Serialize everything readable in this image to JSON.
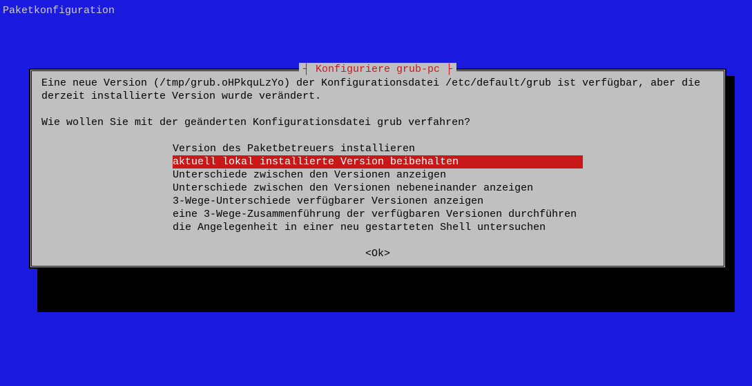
{
  "header": {
    "title": "Paketkonfiguration"
  },
  "dialog": {
    "title": "Konfiguriere grub-pc",
    "body_line1": "Eine neue Version (/tmp/grub.oHPkquLzYo) der Konfigurationsdatei /etc/default/grub ist verfügbar, aber die",
    "body_line2": "derzeit installierte Version wurde verändert.",
    "question": "Wie wollen Sie mit der geänderten Konfigurationsdatei grub verfahren?",
    "options": [
      "Version des Paketbetreuers installieren",
      "aktuell lokal installierte Version beibehalten",
      "Unterschiede zwischen den Versionen anzeigen",
      "Unterschiede zwischen den Versionen nebeneinander anzeigen",
      "3-Wege-Unterschiede verfügbarer Versionen anzeigen",
      "eine 3-Wege-Zusammenführung der verfügbaren Versionen durchführen",
      "die Angelegenheit in einer neu gestarteten Shell untersuchen"
    ],
    "selected_index": 1,
    "ok_label": "<Ok>"
  }
}
